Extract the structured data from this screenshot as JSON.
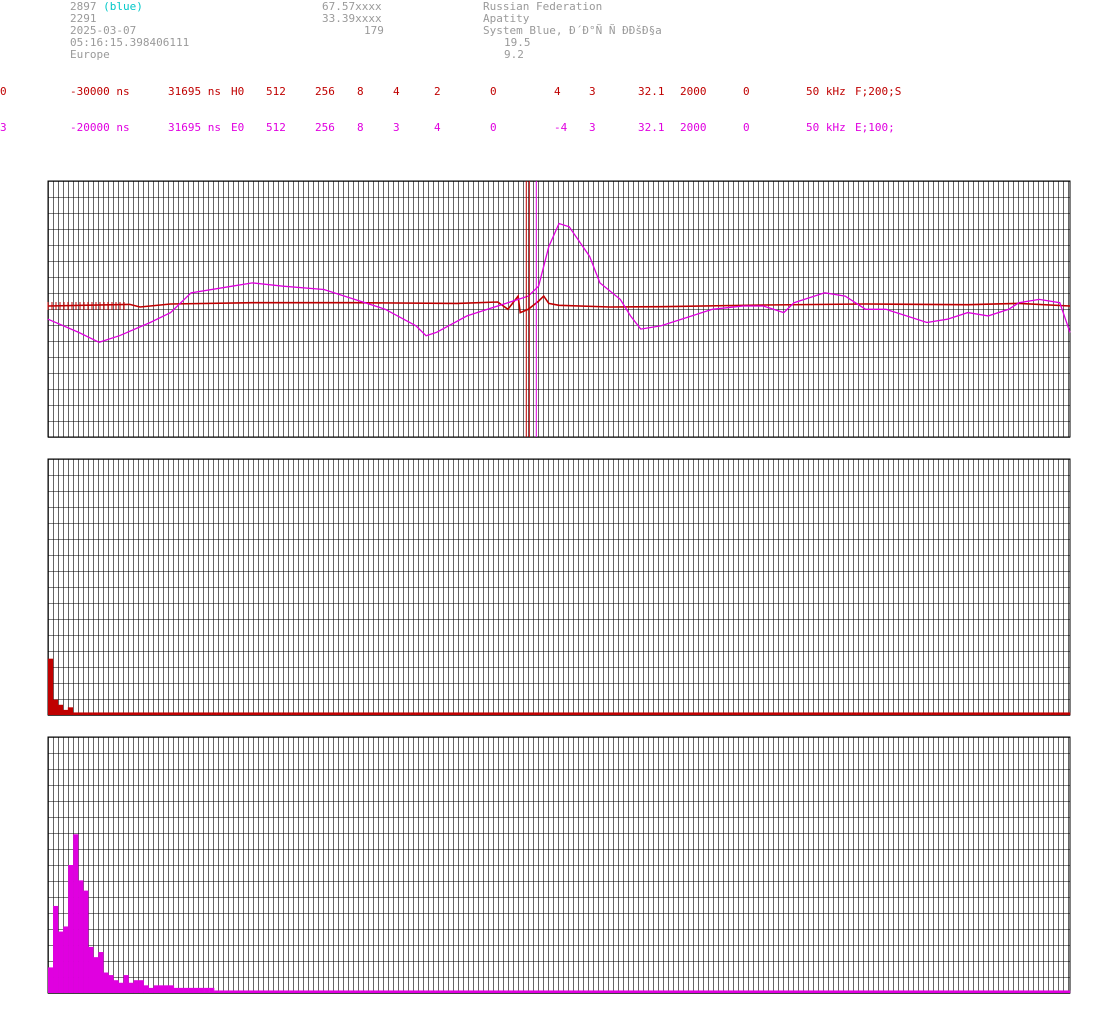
{
  "station": {
    "id": "2897",
    "system_tag": "(blue)",
    "number": "2291",
    "date": "2025-03-07",
    "time": "05:16:15.398406111",
    "region": "Europe",
    "lat": "67.57xxxx",
    "lon": "33.39xxxx",
    "alt": "179",
    "country": "Russian Federation",
    "city": "Apatity",
    "system": "System Blue, Ð´Ð°Ñ Ñ Ð­ÐšÐ§a",
    "value1": "19.5",
    "value2": "9.2"
  },
  "channels": [
    {
      "ch": "0",
      "offset": "-30000 ns",
      "period": "31695 ns",
      "type": "H0",
      "n1": "512",
      "n2": "256",
      "n3": "8",
      "n4": "4",
      "n5": "2",
      "n6": "0",
      "n7": "4",
      "n8": "3",
      "n9": "32.1",
      "n10": "2000",
      "n11": "0",
      "freq": "50 kHz",
      "filter": "F;200;S",
      "color": "#c00000"
    },
    {
      "ch": "3",
      "offset": "-20000 ns",
      "period": "31695 ns",
      "type": "E0",
      "n1": "512",
      "n2": "256",
      "n3": "8",
      "n4": "3",
      "n5": "4",
      "n6": "0",
      "n7": "-4",
      "n8": "3",
      "n9": "32.1",
      "n10": "2000",
      "n11": "0",
      "freq": "50 kHz",
      "filter": "E;100;",
      "color": "#e000e0"
    }
  ],
  "chart_data": [
    {
      "type": "line",
      "series": [
        {
          "color": "#c00000",
          "values": [
            [
              0,
              0
            ],
            [
              0.08,
              0.5
            ],
            [
              0.09,
              -0.3
            ],
            [
              0.12,
              0.6
            ],
            [
              0.2,
              1
            ],
            [
              0.3,
              1
            ],
            [
              0.4,
              0.8
            ],
            [
              0.44,
              1.2
            ],
            [
              0.45,
              -1
            ],
            [
              0.455,
              1
            ],
            [
              0.46,
              3
            ],
            [
              0.462,
              -2
            ],
            [
              0.47,
              -1
            ],
            [
              0.48,
              1.5
            ],
            [
              0.485,
              3
            ],
            [
              0.49,
              0.8
            ],
            [
              0.5,
              0.2
            ],
            [
              0.55,
              -0.3
            ],
            [
              0.6,
              -0.2
            ],
            [
              0.7,
              0.3
            ],
            [
              0.8,
              0.6
            ],
            [
              0.9,
              0.4
            ],
            [
              0.95,
              0.8
            ],
            [
              1,
              0
            ]
          ]
        },
        {
          "color": "#e000e0",
          "values": [
            [
              0,
              -4
            ],
            [
              0.03,
              -8
            ],
            [
              0.05,
              -11
            ],
            [
              0.07,
              -9
            ],
            [
              0.1,
              -5
            ],
            [
              0.12,
              -2
            ],
            [
              0.14,
              4
            ],
            [
              0.18,
              6
            ],
            [
              0.2,
              7
            ],
            [
              0.23,
              6
            ],
            [
              0.27,
              5
            ],
            [
              0.3,
              2
            ],
            [
              0.33,
              -1
            ],
            [
              0.36,
              -6
            ],
            [
              0.37,
              -9
            ],
            [
              0.38,
              -8
            ],
            [
              0.41,
              -3
            ],
            [
              0.43,
              -1
            ],
            [
              0.45,
              1
            ],
            [
              0.47,
              3
            ],
            [
              0.48,
              6
            ],
            [
              0.49,
              18
            ],
            [
              0.5,
              25
            ],
            [
              0.51,
              24
            ],
            [
              0.53,
              15
            ],
            [
              0.54,
              7
            ],
            [
              0.56,
              2
            ],
            [
              0.57,
              -3
            ],
            [
              0.58,
              -7
            ],
            [
              0.6,
              -6
            ],
            [
              0.63,
              -3
            ],
            [
              0.65,
              -1
            ],
            [
              0.68,
              0
            ],
            [
              0.7,
              0
            ],
            [
              0.72,
              -2
            ],
            [
              0.73,
              1
            ],
            [
              0.74,
              2
            ],
            [
              0.76,
              4
            ],
            [
              0.78,
              3
            ],
            [
              0.8,
              -1
            ],
            [
              0.82,
              -1
            ],
            [
              0.84,
              -3
            ],
            [
              0.86,
              -5
            ],
            [
              0.88,
              -4
            ],
            [
              0.9,
              -2
            ],
            [
              0.92,
              -3
            ],
            [
              0.94,
              -1
            ],
            [
              0.95,
              1
            ],
            [
              0.97,
              2
            ],
            [
              0.99,
              1
            ],
            [
              1,
              -8
            ]
          ]
        }
      ]
    },
    {
      "type": "bar",
      "series": [
        {
          "color": "#c00000",
          "values": [
            22,
            6,
            4,
            2,
            3,
            1,
            1,
            1,
            1,
            1,
            1,
            1,
            1,
            1,
            1,
            1,
            1,
            1,
            1,
            1,
            1,
            1,
            1,
            1,
            1,
            1,
            1,
            1,
            1,
            1,
            1,
            1,
            1,
            1,
            1,
            1,
            1,
            1,
            1,
            1,
            1,
            1,
            1,
            1,
            1,
            1,
            1,
            1,
            1,
            1,
            1,
            1,
            1,
            1,
            1,
            1,
            1,
            1,
            1,
            1,
            1,
            1,
            1,
            1,
            1,
            1,
            1,
            1,
            1,
            1,
            1,
            1,
            1,
            1,
            1,
            1,
            1,
            1,
            1,
            1,
            1,
            1,
            1,
            1,
            1,
            1,
            1,
            1,
            1,
            1,
            1,
            1,
            1,
            1,
            1,
            1,
            1,
            1,
            1,
            1,
            1,
            1,
            1,
            1,
            1,
            1,
            1,
            1,
            1,
            1,
            1,
            1,
            1,
            1,
            1,
            1,
            1,
            1,
            1,
            1,
            1,
            1,
            1,
            1,
            1,
            1,
            1,
            1,
            1,
            1,
            1,
            1,
            1,
            1,
            1,
            1,
            1,
            1,
            1,
            1,
            1,
            1,
            1,
            1,
            1,
            1,
            1,
            1,
            1,
            1,
            1,
            1,
            1,
            1,
            1,
            1,
            1,
            1,
            1,
            1,
            1,
            1,
            1,
            1,
            1,
            1,
            1,
            1,
            1,
            1,
            1,
            1,
            1,
            1,
            1,
            1,
            1,
            1,
            1,
            1,
            1,
            1,
            1,
            1,
            1,
            1,
            1,
            1,
            1,
            1,
            1,
            1,
            1,
            1,
            1,
            1,
            1,
            1,
            1,
            1,
            1,
            1,
            1,
            1,
            1,
            1
          ]
        }
      ]
    },
    {
      "type": "bar",
      "series": [
        {
          "color": "#e000e0",
          "values": [
            10,
            34,
            24,
            26,
            50,
            62,
            44,
            40,
            18,
            14,
            16,
            8,
            7,
            5,
            4,
            7,
            4,
            5,
            5,
            3,
            2,
            3,
            3,
            3,
            3,
            2,
            2,
            2,
            2,
            2,
            2,
            2,
            2,
            1,
            1,
            1,
            1,
            1,
            1,
            1,
            1,
            1,
            1,
            1,
            1,
            1,
            1,
            1,
            1,
            1,
            1,
            1,
            1,
            1,
            1,
            1,
            1,
            1,
            1,
            1,
            1,
            1,
            1,
            1,
            1,
            1,
            1,
            1,
            1,
            1,
            1,
            1,
            1,
            1,
            1,
            1,
            1,
            1,
            1,
            1,
            1,
            1,
            1,
            1,
            1,
            1,
            1,
            1,
            1,
            1,
            1,
            1,
            1,
            1,
            1,
            1,
            1,
            1,
            1,
            1,
            1,
            1,
            1,
            1,
            1,
            1,
            1,
            1,
            1,
            1,
            1,
            1,
            1,
            1,
            1,
            1,
            1,
            1,
            1,
            1,
            1,
            1,
            1,
            1,
            1,
            1,
            1,
            1,
            1,
            1,
            1,
            1,
            1,
            1,
            1,
            1,
            1,
            1,
            1,
            1,
            1,
            1,
            1,
            1,
            1,
            1,
            1,
            1,
            1,
            1,
            1,
            1,
            1,
            1,
            1,
            1,
            1,
            1,
            1,
            1,
            1,
            1,
            1,
            1,
            1,
            1,
            1,
            1,
            1,
            1,
            1,
            1,
            1,
            1,
            1,
            1,
            1,
            1,
            1,
            1,
            1,
            1,
            1,
            1,
            1,
            1,
            1,
            1,
            1,
            1,
            1,
            1,
            1,
            1,
            1,
            1,
            1,
            1,
            1,
            1,
            1,
            1,
            1
          ]
        }
      ]
    }
  ]
}
